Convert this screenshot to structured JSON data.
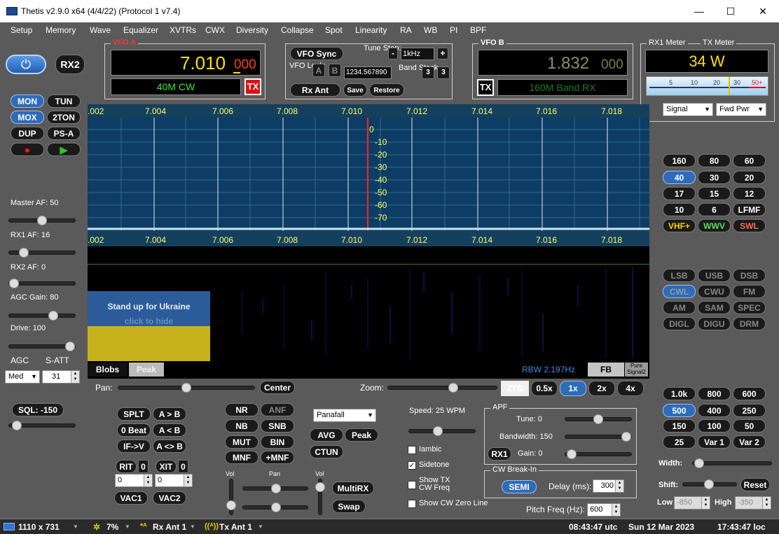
{
  "window": {
    "title": "Thetis v2.9.0 x64 (4/4/22) (Protocol 1 v7.4)",
    "minimize": "—",
    "maximize": "☐",
    "close": "✕"
  },
  "menu": [
    "Setup",
    "Memory",
    "Wave",
    "Equalizer",
    "XVTRs",
    "CWX",
    "Diversity",
    "Collapse",
    "Spot",
    "Linearity",
    "RA",
    "WB",
    "PI",
    "BPF"
  ],
  "left": {
    "rx2": "RX2",
    "mon": "MON",
    "tun": "TUN",
    "mox": "MOX",
    "twoton": "2TON",
    "dup": "DUP",
    "psa": "PS-A",
    "master_af": "Master AF:  50",
    "rx1_af": "RX1 AF:  16",
    "rx2_af": "RX2 AF:  0",
    "agc_gain": "AGC Gain:  80",
    "drive": "Drive:  100",
    "agc": "AGC",
    "s_att": "S-ATT",
    "agc_value": "Med",
    "s_att_value": "31",
    "sql": "SQL: -150"
  },
  "vfo_a": {
    "title": "VFO A",
    "freq_main": "7.010",
    "freq_sub": "000",
    "mode_band": "40M CW",
    "tx": "TX"
  },
  "vfo_center": {
    "vfo_sync": "VFO Sync",
    "tune_step_label": "Tune Step:",
    "tune_step_value": "1kHz",
    "minus": "-",
    "plus": "+",
    "vfo_lock": "VFO Lock:",
    "lock_a": "A",
    "lock_b": "B",
    "lock_code": "1234.567890",
    "band_stack": "Band Stack",
    "bs1": "3",
    "bs2": "3",
    "rx_ant": "Rx Ant",
    "save": "Save",
    "restore": "Restore"
  },
  "vfo_b": {
    "title": "VFO B",
    "freq_main": "1.832",
    "freq_sub": "000",
    "mode_band": "160M Band RX",
    "tx": "TX"
  },
  "meter": {
    "rx1_label": "RX1 Meter",
    "tx_label": "TX Meter",
    "reading": "34 W",
    "scale": [
      "5",
      "10",
      "20",
      "30",
      "50+"
    ],
    "rx_select": "Signal",
    "tx_select": "Fwd Pwr",
    "needle_fraction": 0.68
  },
  "panadapter": {
    "freq_labels": [
      ".002",
      "7.004",
      "7.006",
      "7.008",
      "7.010",
      "7.012",
      "7.014",
      "7.016",
      "7.018"
    ],
    "db_labels": [
      "0",
      "-10",
      "-20",
      "-30",
      "-40",
      "-50",
      "-60",
      "-70"
    ],
    "ukraine_line1": "Stand up for Ukraine",
    "ukraine_line2": "click to hide",
    "blobs": "Blobs",
    "peak": "Peak",
    "rbw": "RBW 2.197Hz",
    "fb": "FB",
    "pure_signal": "Pure Signal2"
  },
  "pan_zoom": {
    "pan": "Pan:",
    "center": "Center",
    "zoom": "Zoom:",
    "ztb": "ZTB",
    "z05": "0.5x",
    "z1": "1x",
    "z2": "2x",
    "z4": "4x"
  },
  "rx_controls": {
    "splt": "SPLT",
    "a_to_b": "A > B",
    "zero_beat": "0 Beat",
    "b_to_a": "A < B",
    "if_v": "IF->V",
    "swap_ab": "A <> B",
    "rit": "RIT",
    "rit_val": "0",
    "rit_field": "0",
    "xit": "XIT",
    "xit_val": "0",
    "xit_field": "0",
    "vac1": "VAC1",
    "vac2": "VAC2"
  },
  "dsp": {
    "nr": "NR",
    "anf": "ANF",
    "nb": "NB",
    "snb": "SNB",
    "mut": "MUT",
    "bin": "BIN",
    "mnf": "MNF",
    "pmnf": "+MNF",
    "display_mode": "Panafall",
    "avg": "AVG",
    "peak": "Peak",
    "ctun": "CTUN",
    "vol_left": "Vol",
    "pan": "Pan",
    "vol_right": "Vol",
    "multirx": "MultiRX",
    "swap": "Swap"
  },
  "cw": {
    "speed": "Speed:  25 WPM",
    "iambic": "Iambic",
    "sidetone": "Sidetone",
    "show_tx_cw": "Show TX CW Freq",
    "show_cw_zero": "Show CW Zero Line",
    "apf_title": "APF",
    "tune": "Tune:  0",
    "bandwidth": "Bandwidth:  150",
    "rx1": "RX1",
    "gain": "Gain:  0",
    "break_in_title": "CW Break-In",
    "semi": "SEMI",
    "delay_label": "Delay (ms):",
    "delay_value": "300",
    "pitch_label": "Pitch Freq (Hz):",
    "pitch_value": "600"
  },
  "bands": [
    "160",
    "80",
    "60",
    "40",
    "30",
    "20",
    "17",
    "15",
    "12",
    "10",
    "6",
    "LFMF",
    "VHF+",
    "WWV",
    "SWL"
  ],
  "modes": [
    "LSB",
    "USB",
    "DSB",
    "CWL",
    "CWU",
    "FM",
    "AM",
    "SAM",
    "SPEC",
    "DIGL",
    "DIGU",
    "DRM"
  ],
  "filters": [
    "1.0k",
    "800",
    "600",
    "500",
    "400",
    "250",
    "150",
    "100",
    "50",
    "25",
    "Var 1",
    "Var 2"
  ],
  "filter_controls": {
    "width": "Width:",
    "shift": "Shift:",
    "reset": "Reset",
    "low": "Low",
    "low_value": "-850",
    "high": "High",
    "high_value": "-350"
  },
  "status": {
    "resolution": "1110 x 731",
    "cpu": "7%",
    "rx_ant": "Rx Ant  1",
    "tx_ant": "Tx Ant  1",
    "utc": "08:43:47 utc",
    "date": "Sun 12 Mar 2023",
    "loc": "17:43:47 loc"
  },
  "colors": {
    "vfo_a_freq": "#ffe000",
    "vfo_a_sub": "#ff3b2f",
    "mode_green": "#38e838",
    "pan_bg": "#0d3d64",
    "grid_label": "#ffff60",
    "tx_red": "#e01010",
    "active_blue": "#2e6bb8"
  }
}
